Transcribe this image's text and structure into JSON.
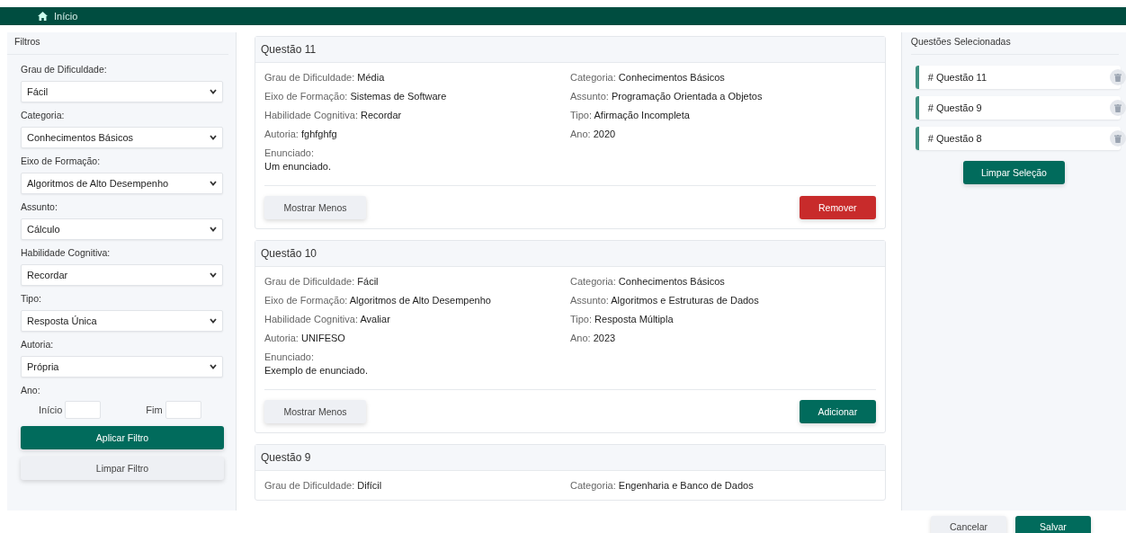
{
  "nav": {
    "home_label": "Início"
  },
  "filters": {
    "title": "Filtros",
    "selects": [
      {
        "label": "Grau de Dificuldade:",
        "value": "Fácil"
      },
      {
        "label": "Categoria:",
        "value": "Conhecimentos Básicos"
      },
      {
        "label": "Eixo de Formação:",
        "value": "Algoritmos de Alto Desempenho"
      },
      {
        "label": "Assunto:",
        "value": "Cálculo"
      },
      {
        "label": "Habilidade Cognitiva:",
        "value": "Recordar"
      },
      {
        "label": "Tipo:",
        "value": "Resposta Única"
      },
      {
        "label": "Autoria:",
        "value": "Própria"
      }
    ],
    "year": {
      "label": "Ano:",
      "start_label": "Início",
      "end_label": "Fim"
    },
    "apply_button": "Aplicar Filtro",
    "clear_button": "Limpar Filtro"
  },
  "questions": [
    {
      "title": "Questão 11",
      "fields": [
        {
          "label": "Grau de Dificuldade:",
          "value": "Média"
        },
        {
          "label": "Categoria:",
          "value": "Conhecimentos Básicos"
        },
        {
          "label": "Eixo de Formação:",
          "value": "Sistemas de Software"
        },
        {
          "label": "Assunto:",
          "value": "Programação Orientada a Objetos"
        },
        {
          "label": "Habilidade Cognitiva:",
          "value": "Recordar"
        },
        {
          "label": "Tipo:",
          "value": "Afirmação Incompleta"
        },
        {
          "label": "Autoria:",
          "value": "fghfghfg"
        },
        {
          "label": "Ano:",
          "value": "2020"
        }
      ],
      "statement_label": "Enunciado:",
      "statement": "Um enunciado.",
      "toggle_button": "Mostrar Menos",
      "action": {
        "label": "Remover",
        "kind": "remove"
      }
    },
    {
      "title": "Questão 10",
      "fields": [
        {
          "label": "Grau de Dificuldade:",
          "value": "Fácil"
        },
        {
          "label": "Categoria:",
          "value": "Conhecimentos Básicos"
        },
        {
          "label": "Eixo de Formação:",
          "value": "Algoritmos de Alto Desempenho"
        },
        {
          "label": "Assunto:",
          "value": "Algoritmos e Estruturas de Dados"
        },
        {
          "label": "Habilidade Cognitiva:",
          "value": "Avaliar"
        },
        {
          "label": "Tipo:",
          "value": "Resposta Múltipla"
        },
        {
          "label": "Autoria:",
          "value": "UNIFESO"
        },
        {
          "label": "Ano:",
          "value": "2023"
        }
      ],
      "statement_label": "Enunciado:",
      "statement": "Exemplo de enunciado.",
      "toggle_button": "Mostrar Menos",
      "action": {
        "label": "Adicionar",
        "kind": "add"
      }
    },
    {
      "title": "Questão 9",
      "fields": [
        {
          "label": "Grau de Dificuldade:",
          "value": "Difícil"
        },
        {
          "label": "Categoria:",
          "value": "Engenharia e Banco de Dados"
        }
      ]
    }
  ],
  "selected": {
    "title": "Questões Selecionadas",
    "items": [
      "# Questão 11",
      "# Questão 9",
      "# Questão 8"
    ],
    "clear_button": "Limpar Seleção"
  },
  "footer": {
    "cancel_button": "Cancelar",
    "save_button": "Salvar"
  }
}
